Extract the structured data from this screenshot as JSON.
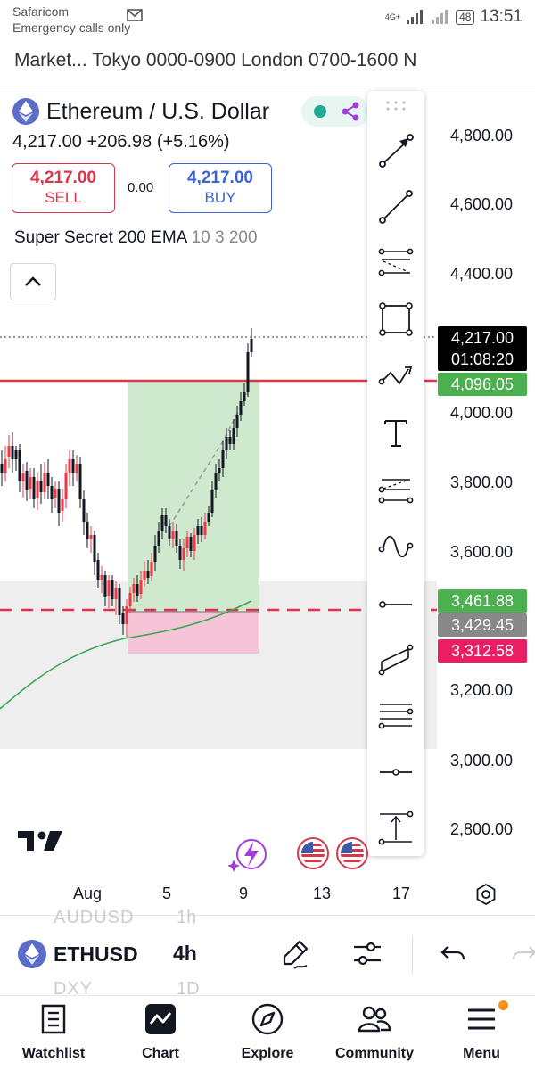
{
  "status_bar": {
    "carrier": "Safaricom",
    "emergency": "Emergency calls only",
    "network": "4G+",
    "battery": "48",
    "time": "13:51"
  },
  "session_hours": "Market... Tokyo 0000-0900 London 0700-1600 N",
  "symbol": {
    "title": "Ethereum / U.S. Dollar",
    "price": "4,217.00",
    "change": "+206.98",
    "change_pct": "(+5.16%)"
  },
  "trade": {
    "sell_price": "4,217.00",
    "sell_label": "SELL",
    "spread": "0.00",
    "buy_price": "4,217.00",
    "buy_label": "BUY"
  },
  "indicator": {
    "name": "Super Secret 200 EMA",
    "params": "10 3 200"
  },
  "price_axis": {
    "labels": [
      "4,800.00",
      "4,600.00",
      "4,400.00",
      "4,000.00",
      "3,800.00",
      "3,600.00",
      "3,200.00",
      "3,000.00",
      "2,800.00"
    ]
  },
  "price_tags": {
    "current": "4,217.00",
    "countdown": "01:08:20",
    "target": "4,096.05",
    "green": "3,461.88",
    "entry": "3,429.45",
    "stop": "3,312.58"
  },
  "colors": {
    "up": "#22ab94",
    "down": "#f23645",
    "red_line": "#d6384a",
    "profit_zone": "#cfe9cf",
    "loss_zone": "#f4c5d6",
    "ema": "#3aa757",
    "accent_purple": "#a23ddc"
  },
  "time_axis": {
    "labels": [
      "Aug",
      "5",
      "9",
      "13",
      "17"
    ]
  },
  "toolbar_icons": [
    "trend-line-arrow-icon",
    "trend-line-icon",
    "fib-retracement-icon",
    "rectangle-icon",
    "path-icon",
    "text-icon",
    "pitchfork-icon",
    "sine-line-icon",
    "horizontal-ray-icon",
    "parallel-channel-icon",
    "horizontal-lines-icon",
    "horizontal-line-icon",
    "price-range-icon"
  ],
  "symbol_bar": {
    "symbol": "ETHUSD",
    "timeframe": "4h",
    "prev_symbol": "AUDUSD",
    "prev_tf": "1h",
    "next_symbol": "DXY",
    "next_tf": "1D"
  },
  "nav": {
    "watchlist": "Watchlist",
    "chart": "Chart",
    "explore": "Explore",
    "community": "Community",
    "menu": "Menu"
  }
}
